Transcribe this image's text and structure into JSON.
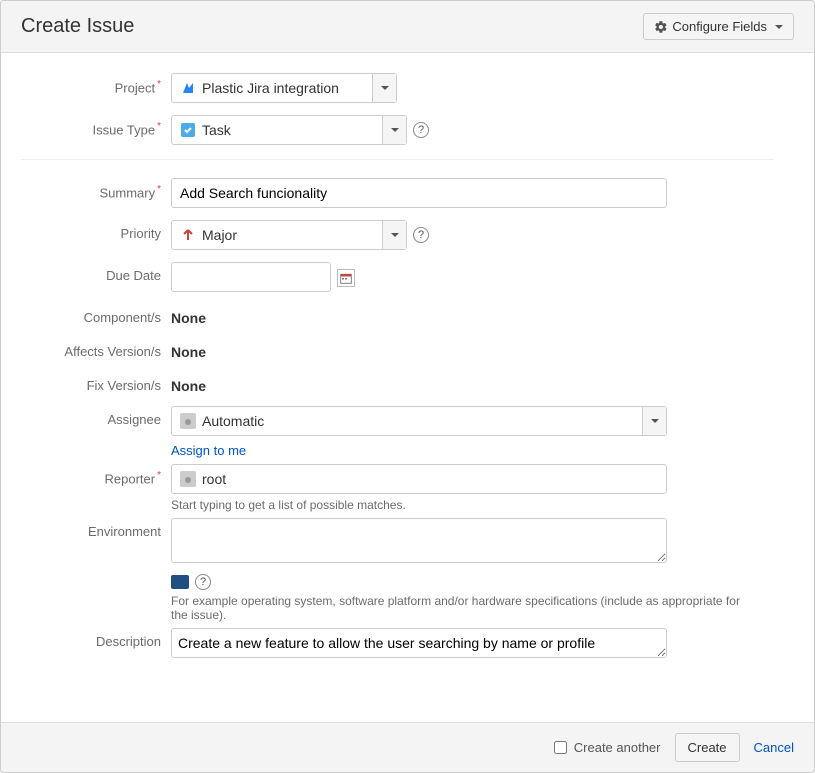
{
  "header": {
    "title": "Create Issue",
    "configure_label": "Configure Fields"
  },
  "form": {
    "project_label": "Project",
    "project_value": "Plastic Jira integration",
    "issue_type_label": "Issue Type",
    "issue_type_value": "Task",
    "summary_label": "Summary",
    "summary_value": "Add Search funcionality",
    "priority_label": "Priority",
    "priority_value": "Major",
    "due_date_label": "Due Date",
    "due_date_value": "",
    "components_label": "Component/s",
    "components_value": "None",
    "affects_versions_label": "Affects Version/s",
    "affects_versions_value": "None",
    "fix_versions_label": "Fix Version/s",
    "fix_versions_value": "None",
    "assignee_label": "Assignee",
    "assignee_value": "Automatic",
    "assign_to_me": "Assign to me",
    "reporter_label": "Reporter",
    "reporter_value": "root",
    "reporter_help": "Start typing to get a list of possible matches.",
    "environment_label": "Environment",
    "environment_value": "",
    "environment_help": "For example operating system, software platform and/or hardware specifications (include as appropriate for the issue).",
    "description_label": "Description",
    "description_value": "Create a new feature to allow the user searching by name or profile"
  },
  "footer": {
    "create_another_label": "Create another",
    "create_label": "Create",
    "cancel_label": "Cancel"
  }
}
